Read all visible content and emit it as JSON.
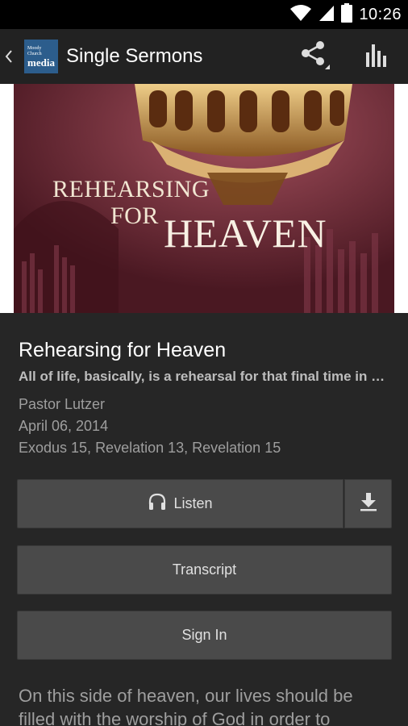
{
  "status_bar": {
    "time": "10:26",
    "icons": [
      "wifi-icon",
      "signal-icon",
      "battery-icon"
    ]
  },
  "action_bar": {
    "title": "Single Sermons",
    "logo_line1": "Moody",
    "logo_line2": "Church",
    "logo_line3": "media",
    "icons": [
      "back-chevron-icon",
      "share-icon",
      "bar-chart-icon"
    ]
  },
  "hero": {
    "line1": "REHEARSING",
    "line2": "FOR",
    "line3": "HEAVEN"
  },
  "sermon": {
    "title": "Rehearsing for Heaven",
    "summary": "All of life, basically, is a rehearsal for that final time in which we will worship God forever",
    "speaker": "Pastor Lutzer",
    "date": "April 06, 2014",
    "references": "Exodus 15, Revelation 13, Revelation 15",
    "description": "On this side of heaven, our lives should be filled with the worship of God in order to"
  },
  "actions": {
    "listen_label": "Listen",
    "transcript_label": "Transcript",
    "signin_label": "Sign In"
  },
  "colors": {
    "background": "#262626",
    "action_bar": "#222222",
    "button": "#4a4a4a",
    "hero_tint": "#6b2937",
    "secondary_text": "#9e9e9e"
  }
}
